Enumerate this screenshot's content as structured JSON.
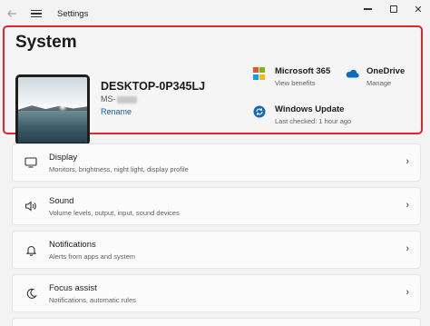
{
  "titlebar": {
    "back_icon": "back-arrow-icon",
    "menu_icon": "hamburger-menu-icon",
    "title": "Settings",
    "minimize_icon": "minimize-icon",
    "maximize_icon": "maximize-icon",
    "close_icon": "close-icon",
    "close_glyph": "✕"
  },
  "system": {
    "title": "System",
    "device_name": "DESKTOP-0P345LJ",
    "device_model_prefix": "MS-",
    "rename_label": "Rename",
    "accent_color": "#0a5fb4",
    "highlight_color": "#e0262d"
  },
  "quick_info": {
    "ms365": {
      "title": "Microsoft 365",
      "subtitle": "View benefits",
      "icon": "microsoft-logo-icon"
    },
    "onedrive": {
      "title": "OneDrive",
      "subtitle": "Manage",
      "icon": "onedrive-cloud-icon"
    },
    "windows_update": {
      "title": "Windows Update",
      "subtitle": "Last checked: 1 hour ago",
      "icon": "windows-update-icon"
    }
  },
  "settings_items": [
    {
      "title": "Display",
      "subtitle": "Monitors, brightness, night light, display profile",
      "icon": "monitor-icon"
    },
    {
      "title": "Sound",
      "subtitle": "Volume levels, output, input, sound devices",
      "icon": "speaker-icon"
    },
    {
      "title": "Notifications",
      "subtitle": "Alerts from apps and system",
      "icon": "bell-icon"
    },
    {
      "title": "Focus assist",
      "subtitle": "Notifications, automatic rules",
      "icon": "moon-icon"
    }
  ],
  "chevron_glyph": "›"
}
